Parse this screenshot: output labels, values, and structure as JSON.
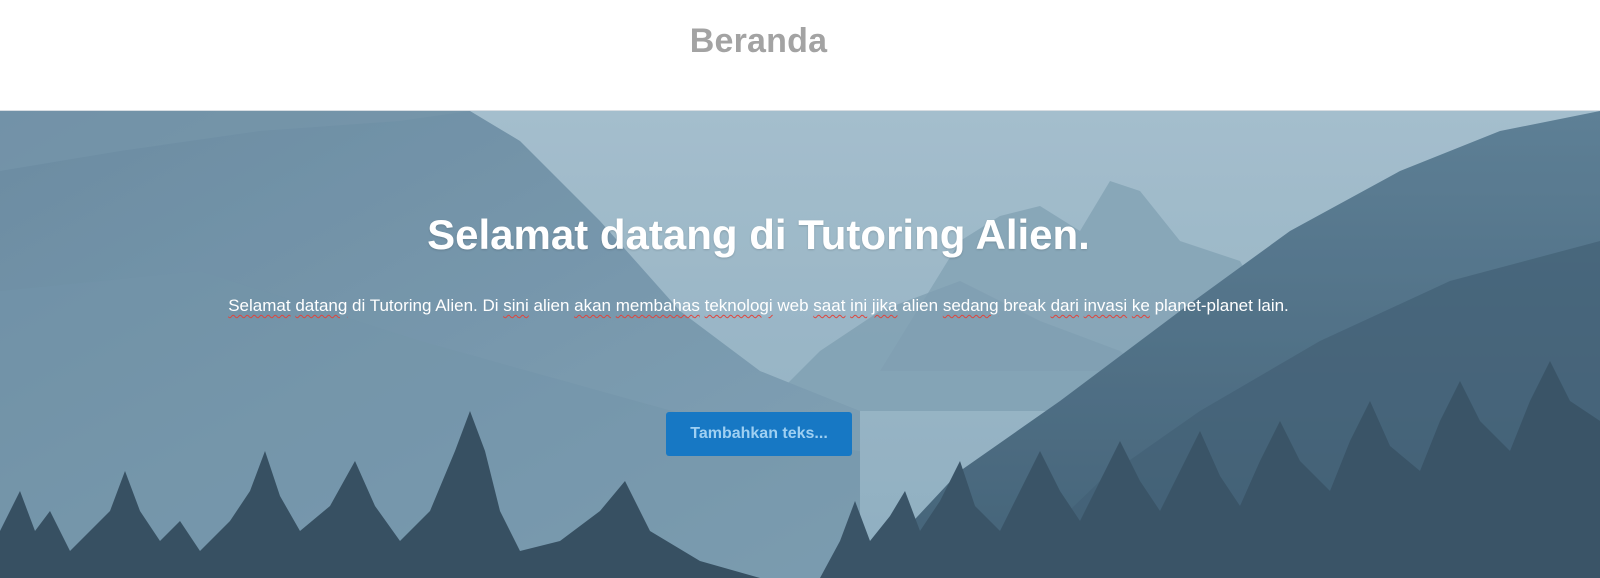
{
  "header": {
    "title": "Beranda"
  },
  "hero": {
    "title": "Selamat datang di Tutoring Alien.",
    "paragraph_parts": [
      {
        "text": "Selamat",
        "misspelled": true
      },
      {
        "text": " ",
        "misspelled": false
      },
      {
        "text": "datang",
        "misspelled": true
      },
      {
        "text": " di Tutoring Alien. Di ",
        "misspelled": false
      },
      {
        "text": "sini",
        "misspelled": true
      },
      {
        "text": " alien ",
        "misspelled": false
      },
      {
        "text": "akan",
        "misspelled": true
      },
      {
        "text": " ",
        "misspelled": false
      },
      {
        "text": "membahas",
        "misspelled": true
      },
      {
        "text": " ",
        "misspelled": false
      },
      {
        "text": "teknologi",
        "misspelled": true
      },
      {
        "text": " web ",
        "misspelled": false
      },
      {
        "text": "saat",
        "misspelled": true
      },
      {
        "text": " ",
        "misspelled": false
      },
      {
        "text": "ini",
        "misspelled": true
      },
      {
        "text": " ",
        "misspelled": false
      },
      {
        "text": "jika",
        "misspelled": true
      },
      {
        "text": " alien ",
        "misspelled": false
      },
      {
        "text": "sedang",
        "misspelled": true
      },
      {
        "text": " break ",
        "misspelled": false
      },
      {
        "text": "dari",
        "misspelled": true
      },
      {
        "text": " ",
        "misspelled": false
      },
      {
        "text": "invasi",
        "misspelled": true
      },
      {
        "text": " ",
        "misspelled": false
      },
      {
        "text": "ke",
        "misspelled": true
      },
      {
        "text": " planet-planet lain.",
        "misspelled": false
      }
    ],
    "button_label": "Tambahkan teks...",
    "background": "mountain-forest-landscape"
  },
  "colors": {
    "header_title": "#a3a3a3",
    "button_bg": "#1778c4",
    "button_text": "#9fd0f2",
    "spellcheck_underline": "#e0443c"
  }
}
